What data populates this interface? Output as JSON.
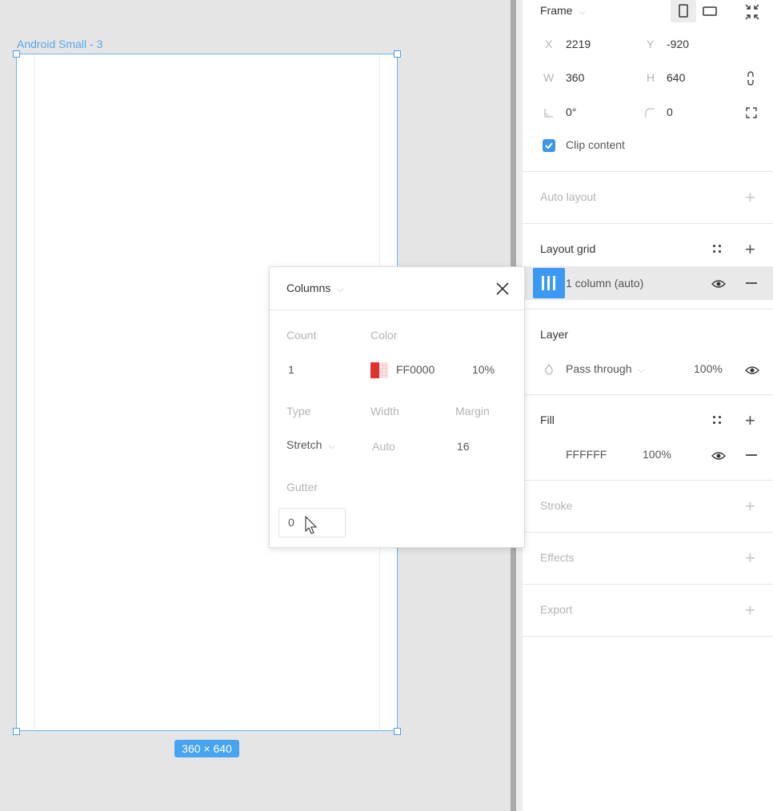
{
  "canvas": {
    "frame_label": "Android Small - 3",
    "size_badge": "360 × 640"
  },
  "popup": {
    "title": "Columns",
    "count_label": "Count",
    "count_value": "1",
    "color_label": "Color",
    "color_hex": "FF0000",
    "color_opacity": "10%",
    "type_label": "Type",
    "type_value": "Stretch",
    "width_label": "Width",
    "width_value": "Auto",
    "margin_label": "Margin",
    "margin_value": "16",
    "gutter_label": "Gutter",
    "gutter_value": "0"
  },
  "panel": {
    "frame": {
      "title": "Frame",
      "x_label": "X",
      "x_value": "2219",
      "y_label": "Y",
      "y_value": "-920",
      "w_label": "W",
      "w_value": "360",
      "h_label": "H",
      "h_value": "640",
      "rotation_value": "0°",
      "radius_value": "0",
      "clip_content": "Clip content"
    },
    "auto_layout": {
      "title": "Auto layout"
    },
    "layout_grid": {
      "title": "Layout grid",
      "item": "1 column (auto)"
    },
    "layer": {
      "title": "Layer",
      "blend_mode": "Pass through",
      "opacity": "100%"
    },
    "fill": {
      "title": "Fill",
      "hex": "FFFFFF",
      "opacity": "100%"
    },
    "stroke": {
      "title": "Stroke"
    },
    "effects": {
      "title": "Effects"
    },
    "export": {
      "title": "Export"
    }
  },
  "colors": {
    "accent": "#3b99f3",
    "selection": "#6bb4ef",
    "grid_color": "#ff0000"
  }
}
